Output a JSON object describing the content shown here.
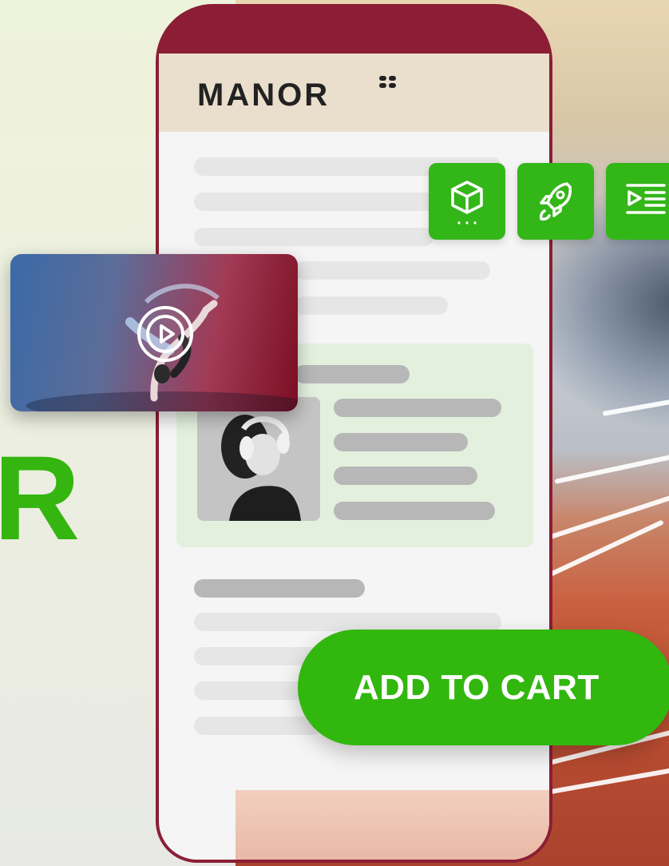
{
  "brand": {
    "name": "MANOR",
    "accent_color": "#31b70e",
    "phone_frame_color": "#8b1e35"
  },
  "hero": {
    "partial_letter": "R"
  },
  "floating_icons": [
    {
      "icon": "box-3d-icon"
    },
    {
      "icon": "rocket-icon"
    },
    {
      "icon": "video-list-icon"
    }
  ],
  "video": {
    "icon": "play-circle-icon"
  },
  "cta": {
    "label": "ADD TO CART"
  }
}
